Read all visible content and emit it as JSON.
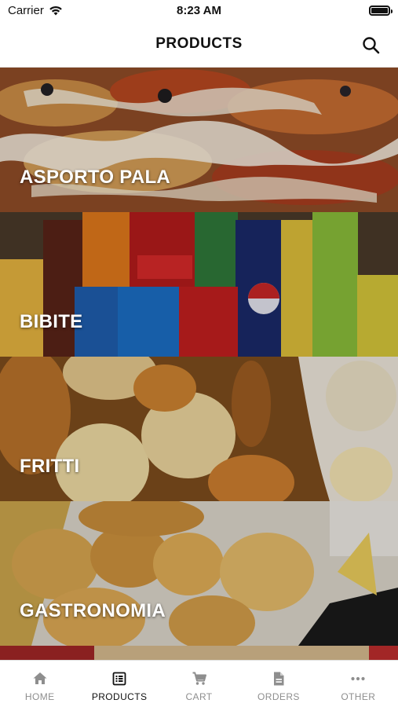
{
  "status_bar": {
    "carrier": "Carrier",
    "time": "8:23 AM"
  },
  "header": {
    "title": "PRODUCTS"
  },
  "categories": [
    {
      "label": "ASPORTO PALA"
    },
    {
      "label": "BIBITE"
    },
    {
      "label": "FRITTI"
    },
    {
      "label": "GASTRONOMIA"
    }
  ],
  "tabs": [
    {
      "label": "HOME",
      "icon": "home-icon",
      "active": false
    },
    {
      "label": "PRODUCTS",
      "icon": "list-icon",
      "active": true
    },
    {
      "label": "CART",
      "icon": "cart-icon",
      "active": false
    },
    {
      "label": "ORDERS",
      "icon": "document-icon",
      "active": false
    },
    {
      "label": "OTHER",
      "icon": "more-icon",
      "active": false
    }
  ],
  "colors": {
    "active_tab": "#111111",
    "inactive_tab": "#8e8e8e"
  }
}
